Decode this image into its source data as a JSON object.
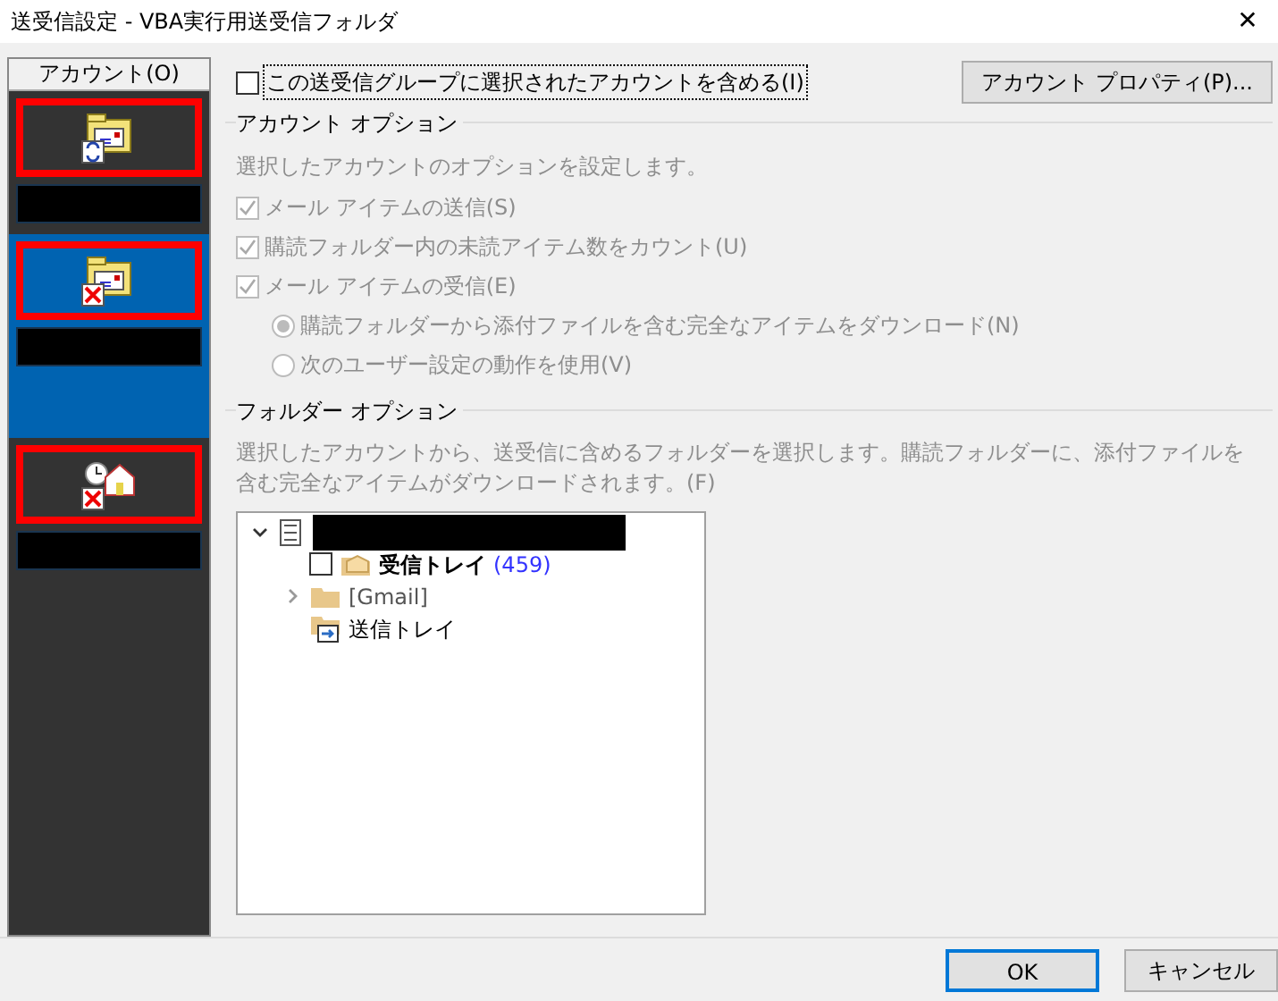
{
  "window": {
    "title": "送受信設定 - VBA実行用送受信フォルダ",
    "close": "✕"
  },
  "sidebar": {
    "header": "アカウント(O)",
    "accounts": [
      {
        "kind": "sync",
        "selected": false,
        "highlighted": true
      },
      {
        "kind": "error",
        "selected": true,
        "highlighted": true
      },
      {
        "kind": "offline",
        "selected": false,
        "highlighted": true
      }
    ]
  },
  "include_checkbox": {
    "label": "この送受信グループに選択されたアカウントを含める(I)",
    "checked": false,
    "focused": true
  },
  "properties_button": "アカウント プロパティ(P)...",
  "account_options": {
    "title": "アカウント オプション",
    "description": "選択したアカウントのオプションを設定します。",
    "items": [
      {
        "kind": "checkbox",
        "label": "メール アイテムの送信(S)",
        "checked": true,
        "disabled": true
      },
      {
        "kind": "checkbox",
        "label": "購読フォルダー内の未読アイテム数をカウント(U)",
        "checked": true,
        "disabled": true
      },
      {
        "kind": "checkbox",
        "label": "メール アイテムの受信(E)",
        "checked": true,
        "disabled": true
      },
      {
        "kind": "radio",
        "label": "購読フォルダーから添付ファイルを含む完全なアイテムをダウンロード(N)",
        "selected": true,
        "disabled": true
      },
      {
        "kind": "radio",
        "label": "次のユーザー設定の動作を使用(V)",
        "selected": false,
        "disabled": true
      }
    ]
  },
  "folder_options": {
    "title": "フォルダー オプション",
    "description": "選択したアカウントから、送受信に含めるフォルダーを選択します。購読フォルダーに、添付ファイルを含む完全なアイテムがダウンロードされます。(F)",
    "tree": [
      {
        "kind": "account",
        "expanded": true,
        "children": [
          {
            "kind": "inbox",
            "label": "受信トレイ",
            "count": "(459)",
            "checked": false
          },
          {
            "kind": "folder",
            "label": "[Gmail]",
            "expanded": false
          },
          {
            "kind": "outbox",
            "label": "送信トレイ"
          }
        ]
      }
    ]
  },
  "buttons": [
    {
      "label": "OK",
      "default": true
    },
    {
      "label": "キャンセル",
      "default": false
    }
  ]
}
